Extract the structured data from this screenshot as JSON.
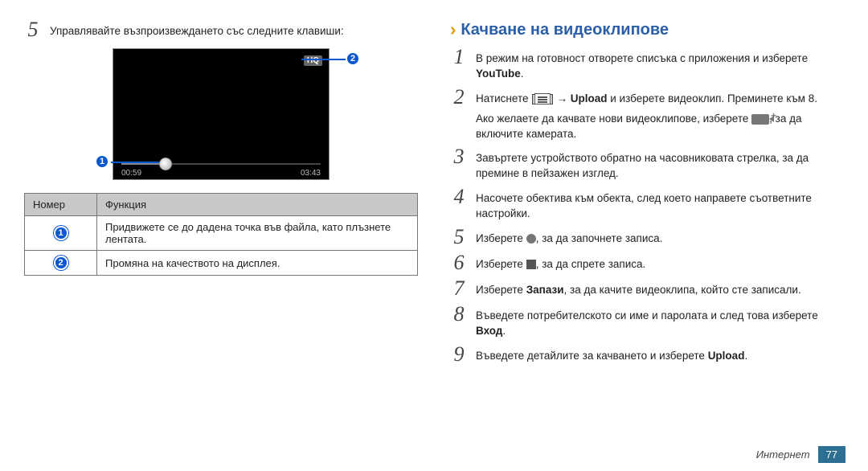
{
  "left": {
    "step5": "Управлявайте възпроизвеждането със следните клавиши:",
    "video": {
      "hq": "HQ",
      "time_l": "00:59",
      "time_r": "03:43"
    },
    "table": {
      "h1": "Номер",
      "h2": "Функция",
      "r1_num": "1",
      "r1": "Придвижете се до дадена точка във файла, като плъзнете лентата.",
      "r2_num": "2",
      "r2": "Промяна на качеството на дисплея."
    }
  },
  "right": {
    "heading": "Качване на видеоклипове",
    "s1a": "В режим на готовност отворете списъка с приложения и изберете ",
    "s1b": "YouTube",
    "s1c": ".",
    "s2a": "Натиснете [",
    "s2b": "] → ",
    "s2c": "Upload",
    "s2d": " и изберете видеоклип. Преминете към 8.",
    "s2_note_a": "Ако желаете да качвате нови видеоклипове, изберете ",
    "s2_note_b": ", за да включите камерата.",
    "s3": "Завъртете устройството обратно на часовниковата стрелка, за да премине в пейзажен изглед.",
    "s4": "Насочете обектива към обекта, след което направете съответните настройки.",
    "s5a": "Изберете ",
    "s5b": ", за да започнете записа.",
    "s6a": "Изберете ",
    "s6b": ", за да спрете записа.",
    "s7a": "Изберете ",
    "s7b": "Запази",
    "s7c": ", за да качите видеоклипа, който сте записали.",
    "s8a": "Въведете потребителското си име и паролата и след това изберете ",
    "s8b": "Вход",
    "s8c": ".",
    "s9a": "Въведете детайлите за качването и изберете ",
    "s9b": "Upload",
    "s9c": "."
  },
  "footer": {
    "label": "Интернет",
    "page": "77"
  }
}
